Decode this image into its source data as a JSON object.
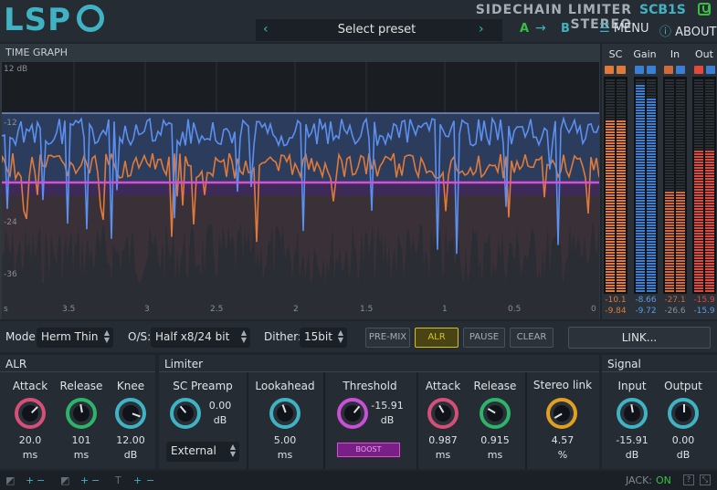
{
  "header": {
    "logo": "LSP",
    "plugin_title": "SIDECHAIN LIMITER STEREO",
    "plugin_code": "SCB1S",
    "preset": {
      "label": "Select preset"
    },
    "ab": {
      "a": "A",
      "arrow": "→",
      "b": "B"
    },
    "menu_label": "MENU",
    "about_label": "ABOUT"
  },
  "graph": {
    "title": "TIME GRAPH",
    "y_labels": [
      "12 dB",
      "-12",
      "-24",
      "-36"
    ],
    "x_labels": [
      "s",
      "3.5",
      "3",
      "2.5",
      "2",
      "1.5",
      "1",
      "0.5",
      "0"
    ]
  },
  "meters": {
    "headers": [
      "SC",
      "Gain",
      "In",
      "Out"
    ],
    "values": {
      "sc": [
        "-10.1",
        "-9.84"
      ],
      "gain": [
        "-8.66",
        "-9.72"
      ],
      "in": [
        "-27.1",
        "-26.6"
      ],
      "out": [
        "-15.9",
        "-15.9"
      ]
    },
    "levels": {
      "sc": [
        0.8,
        0.8
      ],
      "gain": [
        0.97,
        0.91
      ],
      "in": [
        0.48,
        0.48
      ],
      "out": [
        0.67,
        0.67
      ]
    },
    "colors": {
      "sc": "#e07a3a",
      "gain": "#3a7fd4",
      "in": "#d06a3a",
      "out": "#e04a3a"
    }
  },
  "controls": {
    "mode_label": "Mode:",
    "mode_value": "Herm Thin",
    "os_label": "O/S:",
    "os_value": "Half x8/24 bit",
    "dither_label": "Dither:",
    "dither_value": "15bit",
    "buttons": [
      "PRE-MIX",
      "ALR",
      "PAUSE",
      "CLEAR"
    ],
    "link_label": "LINK..."
  },
  "alr": {
    "title": "ALR",
    "knobs": [
      {
        "label": "Attack",
        "value": "20.0",
        "unit": "ms",
        "color": "#d64f78"
      },
      {
        "label": "Release",
        "value": "101",
        "unit": "ms",
        "color": "#2db36a"
      },
      {
        "label": "Knee",
        "value": "12.00",
        "unit": "dB",
        "color": "#3fb3c4"
      }
    ]
  },
  "limiter": {
    "title": "Limiter",
    "sc_preamp": {
      "label": "SC Preamp",
      "value": "0.00",
      "unit": "dB",
      "color": "#3fb3c4",
      "source": "External"
    },
    "lookahead": {
      "label": "Lookahead",
      "value": "5.00",
      "unit": "ms",
      "color": "#3fb3c4"
    },
    "threshold": {
      "label": "Threshold",
      "value": "-15.91",
      "unit": "dB",
      "color": "#c84fd6",
      "boost": "BOOST"
    },
    "attack": {
      "label": "Attack",
      "value": "0.987",
      "unit": "ms",
      "color": "#d64f78"
    },
    "release": {
      "label": "Release",
      "value": "0.915",
      "unit": "ms",
      "color": "#2db36a"
    },
    "stereo_link": {
      "label": "Stereo link",
      "value": "4.57",
      "unit": "%",
      "color": "#e0a020"
    }
  },
  "signal": {
    "title": "Signal",
    "input": {
      "label": "Input",
      "value": "-15.91",
      "unit": "dB",
      "color": "#3fb3c4"
    },
    "output": {
      "label": "Output",
      "value": "0.00",
      "unit": "dB",
      "color": "#3fb3c4"
    }
  },
  "footer": {
    "jack_label": "JACK:",
    "jack_status": "ON",
    "plus": "+",
    "minus": "−"
  }
}
